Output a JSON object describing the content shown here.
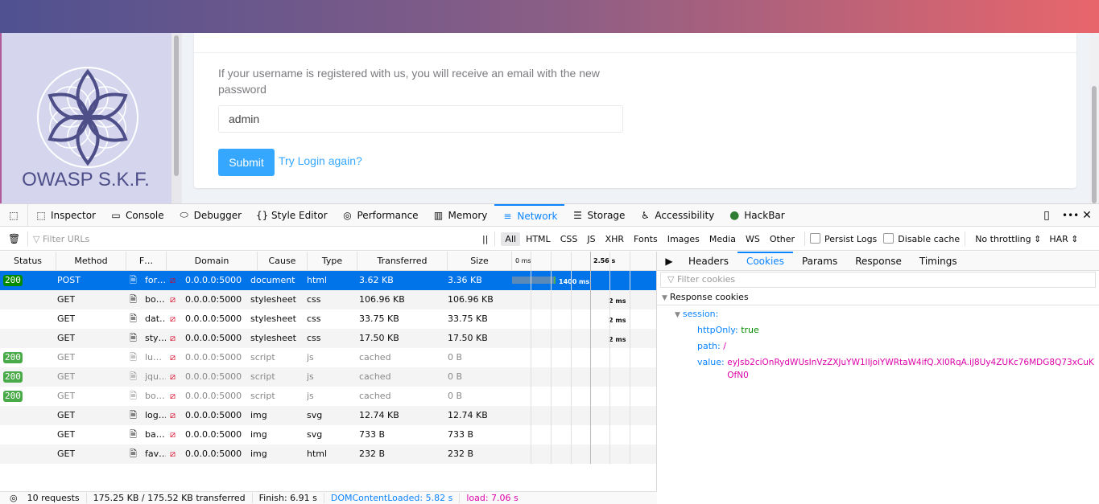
{
  "page": {
    "brand": "OWASP S.K.F.",
    "message": "If your username is registered with us, you will receive an email with the new password",
    "username_value": "admin",
    "submit_label": "Submit",
    "try_login_label": "Try Login again?"
  },
  "devtools": {
    "tabs": [
      {
        "label": "Inspector",
        "icon": "inspector-icon",
        "glyph": "⬚"
      },
      {
        "label": "Console",
        "icon": "console-icon",
        "glyph": "▭"
      },
      {
        "label": "Debugger",
        "icon": "debugger-icon",
        "glyph": "⬭"
      },
      {
        "label": "Style Editor",
        "icon": "style-editor-icon",
        "glyph": "{}"
      },
      {
        "label": "Performance",
        "icon": "performance-icon",
        "glyph": "◎"
      },
      {
        "label": "Memory",
        "icon": "memory-icon",
        "glyph": "▥"
      },
      {
        "label": "Network",
        "icon": "network-icon",
        "glyph": "≡",
        "active": true
      },
      {
        "label": "Storage",
        "icon": "storage-icon",
        "glyph": "☰"
      },
      {
        "label": "Accessibility",
        "icon": "accessibility-icon",
        "glyph": "♿"
      },
      {
        "label": "HackBar",
        "icon": "hackbar-icon",
        "glyph": "●"
      }
    ],
    "filter_placeholder": "Filter URLs",
    "filter_types": [
      "All",
      "HTML",
      "CSS",
      "JS",
      "XHR",
      "Fonts",
      "Images",
      "Media",
      "WS",
      "Other"
    ],
    "persist_logs": "Persist Logs",
    "disable_cache": "Disable cache",
    "throttling": "No throttling",
    "har": "HAR",
    "columns": [
      "Status",
      "Method",
      "F…",
      "Domain",
      "Cause",
      "Type",
      "Transferred",
      "Size",
      "0 ms",
      "2.56 s"
    ],
    "requests": [
      {
        "status": "200",
        "method": "POST",
        "file": "for…",
        "domain": "0.0.0.0:5000",
        "cause": "document",
        "type": "html",
        "transferred": "3.62 KB",
        "size": "3.36 KB",
        "timing": "1400 ms",
        "selected": true
      },
      {
        "status": "",
        "method": "GET",
        "file": "bo…",
        "domain": "0.0.0.0:5000",
        "cause": "stylesheet",
        "type": "css",
        "transferred": "106.96 KB",
        "size": "106.96 KB",
        "timing": "2 ms"
      },
      {
        "status": "",
        "method": "GET",
        "file": "dat…",
        "domain": "0.0.0.0:5000",
        "cause": "stylesheet",
        "type": "css",
        "transferred": "33.75 KB",
        "size": "33.75 KB",
        "timing": "2 ms"
      },
      {
        "status": "",
        "method": "GET",
        "file": "sty…",
        "domain": "0.0.0.0:5000",
        "cause": "stylesheet",
        "type": "css",
        "transferred": "17.50 KB",
        "size": "17.50 KB",
        "timing": "2 ms"
      },
      {
        "status": "200",
        "method": "GET",
        "file": "lu…",
        "domain": "0.0.0.0:5000",
        "cause": "script",
        "type": "js",
        "transferred": "cached",
        "size": "0 B",
        "timing": "",
        "dim": true
      },
      {
        "status": "200",
        "method": "GET",
        "file": "jqu…",
        "domain": "0.0.0.0:5000",
        "cause": "script",
        "type": "js",
        "transferred": "cached",
        "size": "0 B",
        "timing": "",
        "dim": true
      },
      {
        "status": "200",
        "method": "GET",
        "file": "bo…",
        "domain": "0.0.0.0:5000",
        "cause": "script",
        "type": "js",
        "transferred": "cached",
        "size": "0 B",
        "timing": "",
        "dim": true
      },
      {
        "status": "",
        "method": "GET",
        "file": "log…",
        "domain": "0.0.0.0:5000",
        "cause": "img",
        "type": "svg",
        "transferred": "12.74 KB",
        "size": "12.74 KB",
        "timing": ""
      },
      {
        "status": "",
        "method": "GET",
        "file": "ba…",
        "domain": "0.0.0.0:5000",
        "cause": "img",
        "type": "svg",
        "transferred": "733 B",
        "size": "733 B",
        "timing": ""
      },
      {
        "status": "",
        "method": "GET",
        "file": "fav…",
        "domain": "0.0.0.0:5000",
        "cause": "img",
        "type": "html",
        "transferred": "232 B",
        "size": "232 B",
        "timing": ""
      }
    ],
    "panel": {
      "tabs": [
        "Headers",
        "Cookies",
        "Params",
        "Response",
        "Timings"
      ],
      "active_tab": "Cookies",
      "filter_placeholder": "Filter cookies",
      "section": "Response cookies",
      "cookie_name": "session:",
      "httpOnly_key": "httpOnly:",
      "httpOnly_value": "true",
      "path_key": "path:",
      "path_value": "/",
      "value_key": "value:",
      "value_value": "eyJsb2ciOnRydWUsInVzZXJuYW1lIjoiYWRtaW4ifQ.Xl0RqA.iJ8Uy4ZUKc76MDG8Q73xCuKOfN0"
    },
    "status": {
      "requests": "10 requests",
      "transferred": "175.25 KB / 175.52 KB transferred",
      "finish": "Finish: 6.91 s",
      "dcl": "DOMContentLoaded: 5.82 s",
      "load": "load: 7.06 s"
    }
  }
}
